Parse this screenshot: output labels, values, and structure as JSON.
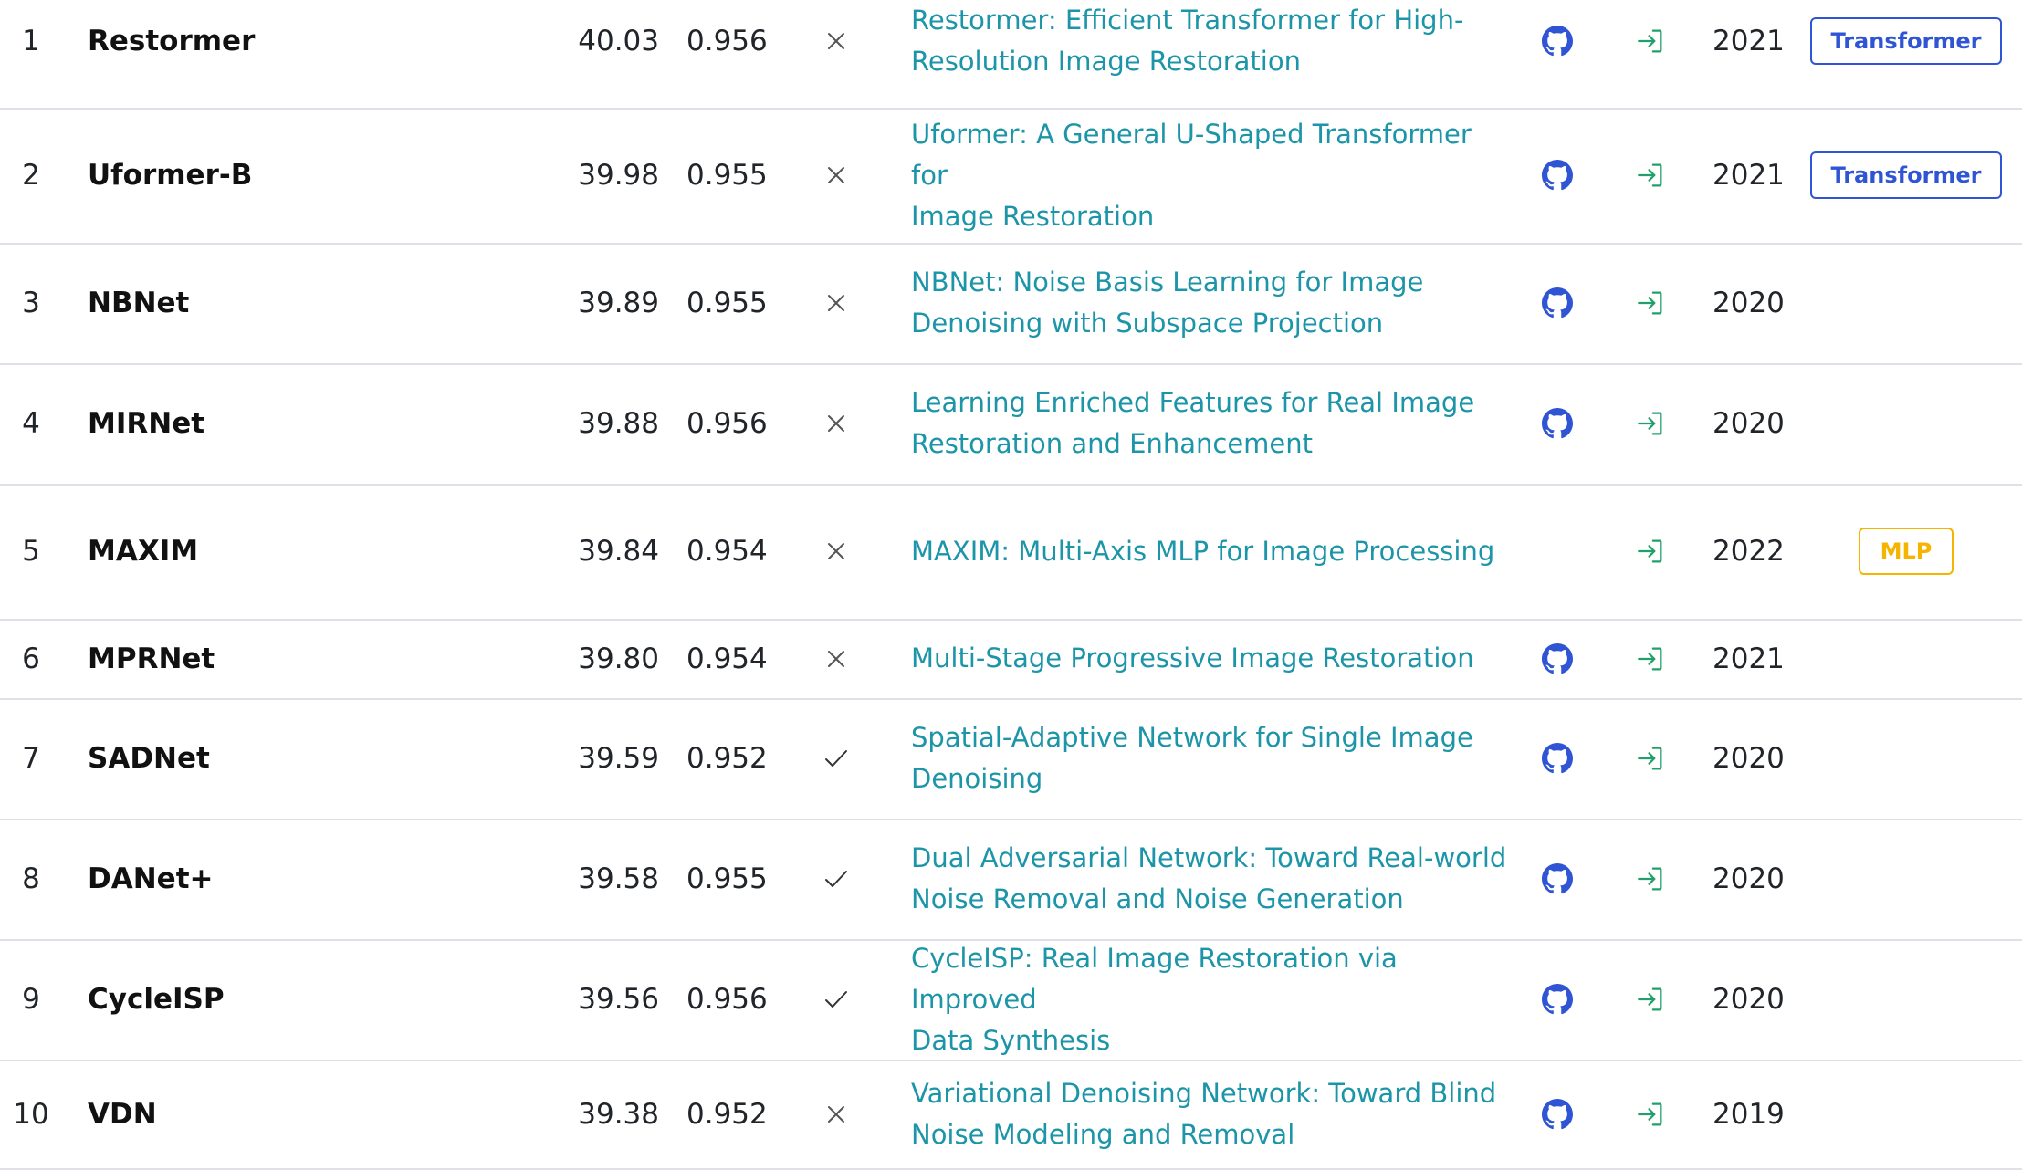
{
  "colors": {
    "link": "#1c95a8",
    "github_icon": "#2f55d4",
    "result_icon": "#22a06b",
    "tag_transformer": "#2f55d4",
    "tag_mlp": "#f5b400",
    "divider": "#dee2e6"
  },
  "icons": {
    "extra_training_no": "cross-icon",
    "extra_training_yes": "check-icon",
    "code": "github-icon",
    "result": "sign-in-icon"
  },
  "rows": [
    {
      "rank": "1",
      "model": "Restormer",
      "psnr": "40.03",
      "ssim": "0.956",
      "extra_data": false,
      "paper_line1": "Restormer: Efficient Transformer for High-",
      "paper_line2": "Resolution Image Restoration",
      "has_code": true,
      "has_result": true,
      "year": "2021",
      "tag": "Transformer"
    },
    {
      "rank": "2",
      "model": "Uformer-B",
      "psnr": "39.98",
      "ssim": "0.955",
      "extra_data": false,
      "paper_line1": "Uformer: A General U-Shaped Transformer for",
      "paper_line2": "Image Restoration",
      "has_code": true,
      "has_result": true,
      "year": "2021",
      "tag": "Transformer"
    },
    {
      "rank": "3",
      "model": "NBNet",
      "psnr": "39.89",
      "ssim": "0.955",
      "extra_data": false,
      "paper_line1": "NBNet: Noise Basis Learning for Image",
      "paper_line2": "Denoising with Subspace Projection",
      "has_code": true,
      "has_result": true,
      "year": "2020",
      "tag": ""
    },
    {
      "rank": "4",
      "model": "MIRNet",
      "psnr": "39.88",
      "ssim": "0.956",
      "extra_data": false,
      "paper_line1": "Learning Enriched Features for Real Image",
      "paper_line2": "Restoration and Enhancement",
      "has_code": true,
      "has_result": true,
      "year": "2020",
      "tag": ""
    },
    {
      "rank": "5",
      "model": "MAXIM",
      "psnr": "39.84",
      "ssim": "0.954",
      "extra_data": false,
      "paper_line1": "MAXIM: Multi-Axis MLP for Image Processing",
      "paper_line2": "",
      "has_code": false,
      "has_result": true,
      "year": "2022",
      "tag": "MLP"
    },
    {
      "rank": "6",
      "model": "MPRNet",
      "psnr": "39.80",
      "ssim": "0.954",
      "extra_data": false,
      "paper_line1": "Multi-Stage Progressive Image Restoration",
      "paper_line2": "",
      "has_code": true,
      "has_result": true,
      "year": "2021",
      "tag": ""
    },
    {
      "rank": "7",
      "model": "SADNet",
      "psnr": "39.59",
      "ssim": "0.952",
      "extra_data": true,
      "paper_line1": "Spatial-Adaptive Network for Single Image",
      "paper_line2": "Denoising",
      "has_code": true,
      "has_result": true,
      "year": "2020",
      "tag": ""
    },
    {
      "rank": "8",
      "model": "DANet+",
      "psnr": "39.58",
      "ssim": "0.955",
      "extra_data": true,
      "paper_line1": "Dual Adversarial Network: Toward Real-world",
      "paper_line2": "Noise Removal and Noise Generation",
      "has_code": true,
      "has_result": true,
      "year": "2020",
      "tag": ""
    },
    {
      "rank": "9",
      "model": "CycleISP",
      "psnr": "39.56",
      "ssim": "0.956",
      "extra_data": true,
      "paper_line1": "CycleISP: Real Image Restoration via Improved",
      "paper_line2": "Data Synthesis",
      "has_code": true,
      "has_result": true,
      "year": "2020",
      "tag": ""
    },
    {
      "rank": "10",
      "model": "VDN",
      "psnr": "39.38",
      "ssim": "0.952",
      "extra_data": false,
      "paper_line1": "Variational Denoising Network: Toward Blind",
      "paper_line2": "Noise Modeling and Removal",
      "has_code": true,
      "has_result": true,
      "year": "2019",
      "tag": ""
    }
  ]
}
